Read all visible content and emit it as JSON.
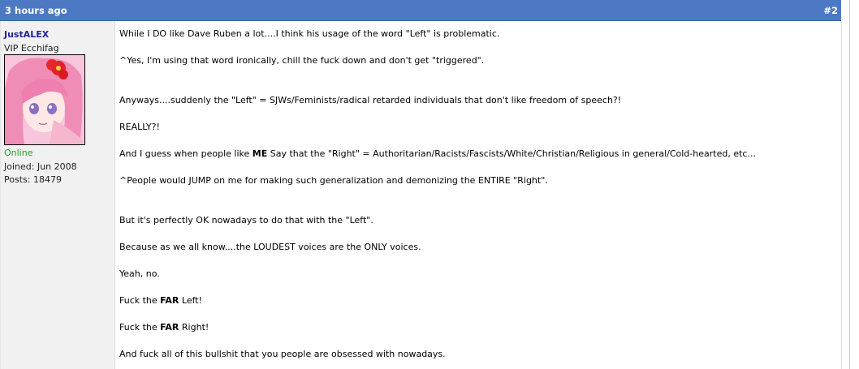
{
  "post": {
    "date": "3 hours ago",
    "number": "#2"
  },
  "user": {
    "name": "JustALEX",
    "title": "VIP Ecchifag",
    "status": "Online",
    "joined": "Joined: Jun 2008",
    "posts": "Posts: 18479"
  },
  "body": {
    "l1": "While I DO like Dave Ruben a lot....I think his usage of the word \"Left\" is problematic.",
    "l2": "^Yes, I'm using that word ironically, chill the fuck down and don't get \"triggered\".",
    "l3": "Anyways....suddenly the \"Left\" = SJWs/Feminists/radical retarded individuals that don't like freedom of speech?!",
    "l4": "REALLY?!",
    "l5a": "And I guess when people like ",
    "l5b": "ME",
    "l5c": " Say that the \"Right\" = Authoritarian/Racists/Fascists/White/Christian/Religious in general/Cold-hearted, etc...",
    "l6": "^People would JUMP on me for making such generalization and demonizing the ENTIRE \"Right\".",
    "l7": "But it's perfectly OK nowadays to do that with the \"Left\".",
    "l8": "Because as we all know....the LOUDEST voices are the ONLY voices.",
    "l9": "Yeah, no.",
    "l10a": "Fuck the ",
    "l10b": "FAR",
    "l10c": " Left!",
    "l11a": "Fuck the ",
    "l11b": "FAR",
    "l11c": " Right!",
    "l12": "And fuck all of this bullshit that you people are obsessed with nowadays."
  },
  "colors": {
    "header": "#4d79c4",
    "username": "#22229c",
    "online": "#2a9a2a"
  }
}
